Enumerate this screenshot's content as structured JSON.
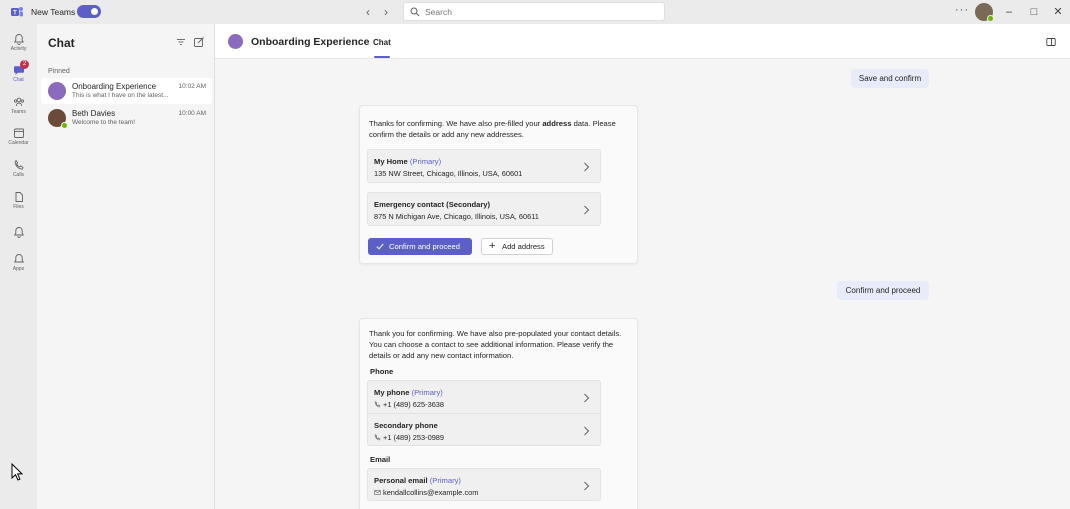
{
  "topbar": {
    "app_toggle_label": "New Teams",
    "search_placeholder": "Search",
    "more_icon": "more-horizontal-icon"
  },
  "rail": {
    "items": [
      {
        "label": "Activity",
        "icon": "bell-icon"
      },
      {
        "label": "Chat",
        "icon": "chat-icon",
        "badge": "2"
      },
      {
        "label": "Teams",
        "icon": "teams-icon"
      },
      {
        "label": "Calendar",
        "icon": "calendar-icon"
      },
      {
        "label": "Calls",
        "icon": "phone-icon"
      },
      {
        "label": "Files",
        "icon": "file-icon"
      },
      {
        "label": "",
        "icon": "notification-icon"
      },
      {
        "label": "Apps",
        "icon": "apps-icon"
      }
    ]
  },
  "chatlist": {
    "title": "Chat",
    "section_pinned": "Pinned",
    "chats": [
      {
        "name": "Onboarding Experience",
        "preview": "This is what I have on the latest...",
        "time": "10:02 AM"
      },
      {
        "name": "Beth Davies",
        "preview": "Welcome to the team!",
        "time": "10:00 AM"
      }
    ]
  },
  "conversation": {
    "title": "Onboarding Experience",
    "tab": "Chat",
    "pill_save": "Save and confirm",
    "pill_confirm": "Confirm and proceed"
  },
  "address_card": {
    "intro_pre": "Thanks for confirming. We have also pre-filled your ",
    "intro_bold": "address",
    "intro_post": " data. Please confirm the details or add any new addresses.",
    "options": [
      {
        "title": "My Home",
        "tag": "(Primary)",
        "detail": "135 NW Street, Chicago, Illinois, USA, 60601"
      },
      {
        "title": "Emergency contact (Secondary)",
        "tag": "",
        "detail": "875 N Michigan Ave, Chicago, Illinois, USA, 60611"
      }
    ],
    "confirm_button": "Confirm and proceed",
    "add_button": "Add address"
  },
  "contact_card": {
    "intro": "Thank you for confirming. We have also pre-populated your contact details. You can choose a contact to see additional information. Please verify the details or add any new contact information.",
    "phone_label": "Phone",
    "phones": [
      {
        "title": "My phone",
        "tag": "(Primary)",
        "detail": "+1 (489) 625-3638"
      },
      {
        "title": "Secondary phone",
        "tag": "",
        "detail": "+1 (489) 253-0989"
      }
    ],
    "email_label": "Email",
    "emails": [
      {
        "title": "Personal email",
        "tag": "(Primary)",
        "detail": "kendallcollins@example.com"
      }
    ]
  },
  "colors": {
    "accent": "#5b5fc7",
    "pill_bg": "#e8ebfa",
    "presence": "#6bb700",
    "badge": "#c4314b"
  }
}
